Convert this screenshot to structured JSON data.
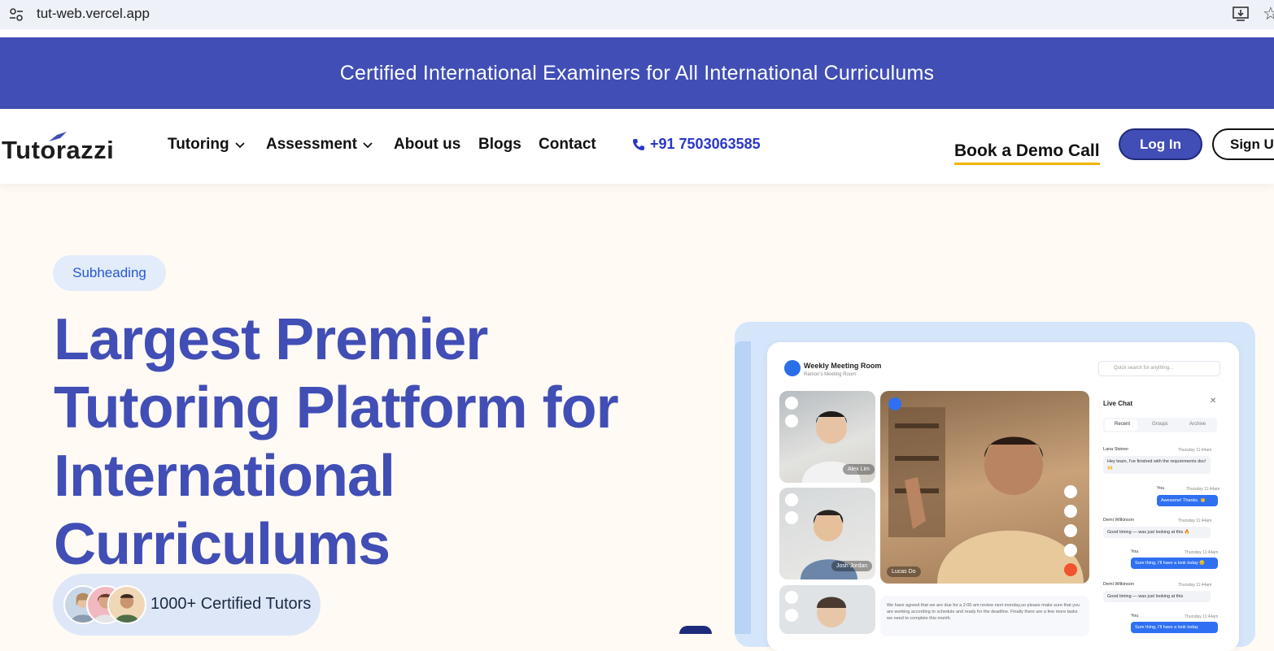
{
  "browser": {
    "url": "tut-web.vercel.app"
  },
  "announcement": "Certified International Examiners for All International Curriculums",
  "logo": "Tutorazzi",
  "nav": {
    "items": [
      "Tutoring",
      "Assessment",
      "About us",
      "Blogs",
      "Contact"
    ],
    "phone": "+91 7503063585",
    "demo": "Book a Demo Call",
    "login": "Log In",
    "signup": "Sign Up"
  },
  "hero": {
    "subheading": "Subheading",
    "title": "Largest Premier Tutoring Platform for International Curriculums",
    "tutors": "1000+ Certified Tutors"
  },
  "mockup": {
    "room_title": "Weekly Meeting Room",
    "room_sub": "Ramon's Meeting Room",
    "search_placeholder": "Quick search for anything...",
    "participants": [
      "Alex Lim",
      "Josh Jordan",
      "Lucas Do"
    ],
    "chat": {
      "title": "Live Chat",
      "tabs": [
        "Recent",
        "Groups",
        "Archive"
      ],
      "messages": [
        {
          "name": "Lana Steiner",
          "time": "Thursday 11:44am",
          "text": "Hey team, I've finished with the requirements doc! 🙌",
          "side": "in"
        },
        {
          "name": "You",
          "time": "Thursday 11:44am",
          "text": "Awesome! Thanks. 👏",
          "side": "out"
        },
        {
          "name": "Demi Wilkinson",
          "time": "Thursday 11:44am",
          "text": "Good timing — was just looking at this 🔥",
          "side": "in"
        },
        {
          "name": "You",
          "time": "Thursday 11:44am",
          "text": "Sure thing, I'll have a look today 😊",
          "side": "out"
        },
        {
          "name": "Demi Wilkinson",
          "time": "Thursday 11:44am",
          "text": "Good timing — was just looking at this",
          "side": "in"
        },
        {
          "name": "You",
          "time": "Thursday 11:44am",
          "text": "Sure thing, I'll have a look today",
          "side": "out"
        }
      ]
    },
    "notes": "We have agreed that we are due for a 2:00 am review next monday,so please make sure that you are working according to schedule and ready for the deadline. Finally there are a few more tasks we need to complete this month."
  },
  "colors": {
    "brand": "#414eb5",
    "accent": "#f3b400",
    "phone": "#2a36c8"
  }
}
